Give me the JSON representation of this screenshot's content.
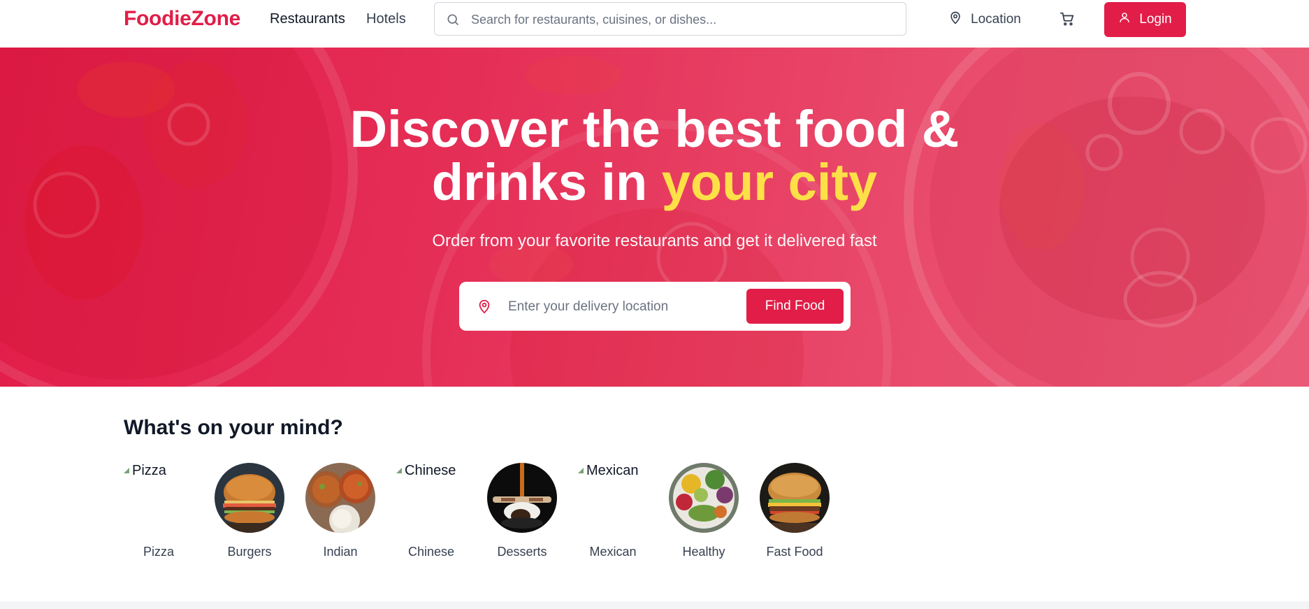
{
  "header": {
    "logo": "FoodieZone",
    "nav": [
      "Restaurants",
      "Hotels"
    ],
    "search_placeholder": "Search for restaurants, cuisines, or dishes...",
    "location_label": "Location",
    "login_label": "Login"
  },
  "hero": {
    "title_line1": "Discover the best food &",
    "title_line2_prefix": "drinks in ",
    "title_line2_accent": "your city",
    "subtitle": "Order from your favorite restaurants and get it delivered fast",
    "location_placeholder": "Enter your delivery location",
    "find_button": "Find Food"
  },
  "categories_section": {
    "title": "What's on your mind?",
    "items": [
      {
        "label": "Pizza",
        "image_alt": "Pizza",
        "image_loaded": false
      },
      {
        "label": "Burgers",
        "image_loaded": true
      },
      {
        "label": "Indian",
        "image_loaded": true
      },
      {
        "label": "Chinese",
        "image_alt": "Chinese",
        "image_loaded": false
      },
      {
        "label": "Desserts",
        "image_loaded": true
      },
      {
        "label": "Mexican",
        "image_alt": "Mexican",
        "image_loaded": false
      },
      {
        "label": "Healthy",
        "image_loaded": true
      },
      {
        "label": "Fast Food",
        "image_loaded": true
      }
    ]
  },
  "colors": {
    "brand": "#e11d48",
    "accent": "#fde047",
    "text_dark": "#111827",
    "text_muted": "#374151"
  },
  "icons": [
    "search-icon",
    "map-pin-icon",
    "cart-icon",
    "user-icon"
  ]
}
